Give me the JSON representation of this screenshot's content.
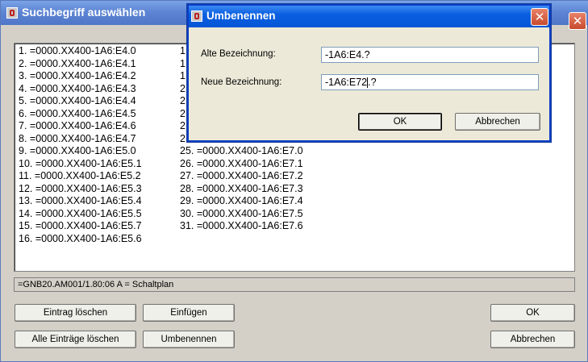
{
  "main_window": {
    "title": "Suchbegriff auswählen",
    "list_items_col1": [
      "1. =0000.XX400-1A6:E4.0",
      "2. =0000.XX400-1A6:E4.1",
      "3. =0000.XX400-1A6:E4.2",
      "4. =0000.XX400-1A6:E4.3",
      "5. =0000.XX400-1A6:E4.4",
      "6. =0000.XX400-1A6:E4.5",
      "7. =0000.XX400-1A6:E4.6",
      "8. =0000.XX400-1A6:E4.7",
      "9. =0000.XX400-1A6:E5.0",
      "10. =0000.XX400-1A6:E5.1",
      "11. =0000.XX400-1A6:E5.2",
      "12. =0000.XX400-1A6:E5.3",
      "13. =0000.XX400-1A6:E5.4",
      "14. =0000.XX400-1A6:E5.5",
      "15. =0000.XX400-1A6:E5.7",
      "16. =0000.XX400-1A6:E5.6"
    ],
    "list_items_col2_partial": [
      "1",
      "1",
      "1",
      "2",
      "2",
      "2",
      "2",
      "2"
    ],
    "list_items_col2": [
      "25. =0000.XX400-1A6:E7.0",
      "26. =0000.XX400-1A6:E7.1",
      "27. =0000.XX400-1A6:E7.2",
      "28. =0000.XX400-1A6:E7.3",
      "29. =0000.XX400-1A6:E7.4",
      "30. =0000.XX400-1A6:E7.5",
      "31. =0000.XX400-1A6:E7.6"
    ],
    "status_text": "=GNB20.AM001/1.80:06 A = Schaltplan",
    "buttons": {
      "delete_entry": "Eintrag löschen",
      "insert": "Einfügen",
      "ok": "OK",
      "delete_all": "Alle Einträge löschen",
      "rename": "Umbenennen",
      "cancel": "Abbrechen"
    }
  },
  "rename_dialog": {
    "title": "Umbenennen",
    "old_label": "Alte Bezeichnung:",
    "old_value": "-1A6:E4.?",
    "new_label": "Neue Bezeichnung:",
    "new_value_before_caret": "-1A6:E72",
    "new_value_after_caret": ".?",
    "ok": "OK",
    "cancel": "Abbrechen"
  },
  "colors": {
    "main_titlebar": "#5d85d4",
    "dialog_titlebar": "#0a5fe0",
    "close_button": "#c84b2d"
  }
}
